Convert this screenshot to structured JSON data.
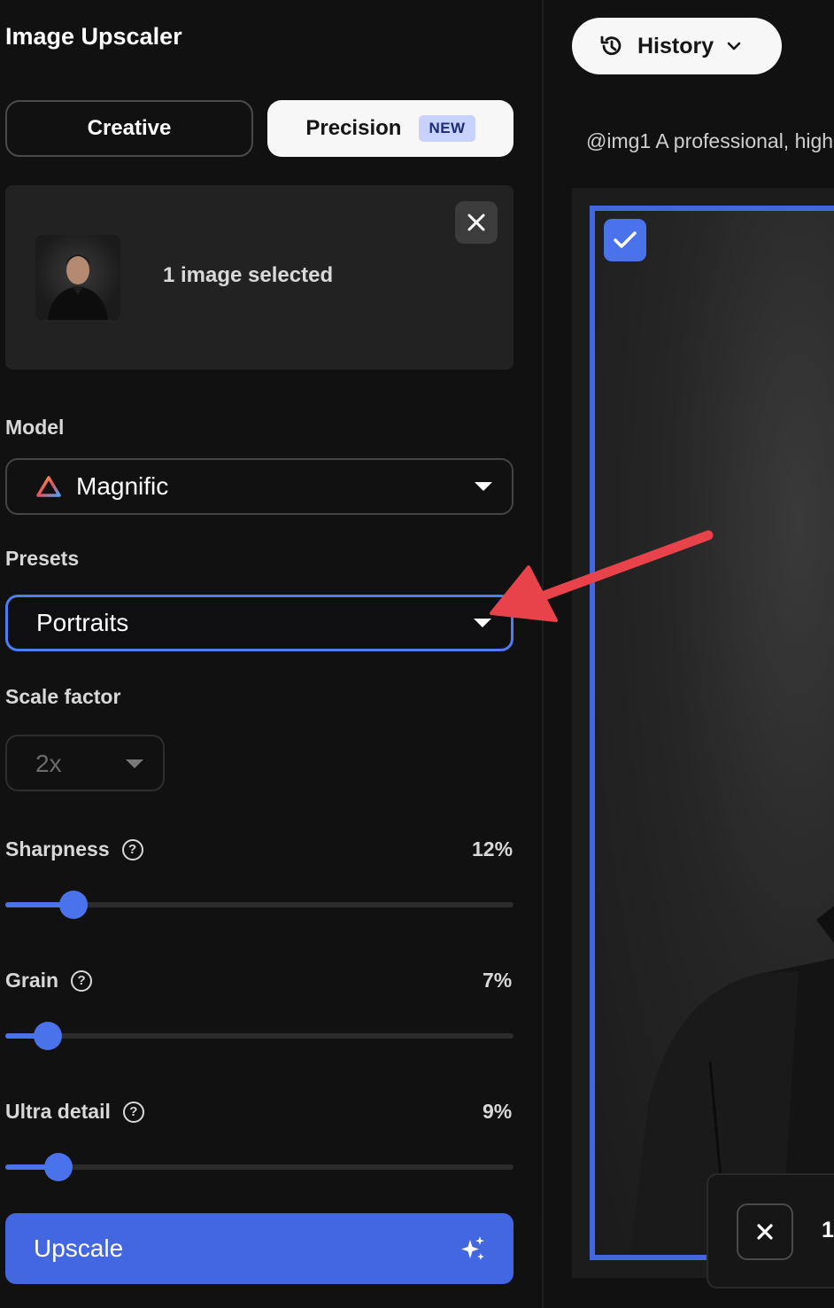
{
  "app": {
    "title": "Image Upscaler"
  },
  "modes": {
    "creative_label": "Creative",
    "precision_label": "Precision",
    "new_badge": "NEW",
    "active": "Precision"
  },
  "selection": {
    "text": "1 image selected"
  },
  "model": {
    "label": "Model",
    "value": "Magnific"
  },
  "presets": {
    "label": "Presets",
    "value": "Portraits"
  },
  "scale": {
    "label": "Scale factor",
    "value": "2x"
  },
  "sliders": [
    {
      "label": "Sharpness",
      "value_text": "12%",
      "value": 12
    },
    {
      "label": "Grain",
      "value_text": "7%",
      "value": 7
    },
    {
      "label": "Ultra detail",
      "value_text": "9%",
      "value": 9
    }
  ],
  "upscale": {
    "label": "Upscale"
  },
  "history": {
    "label": "History"
  },
  "prompt": {
    "text": "@img1 A professional, high"
  },
  "bottom_bar": {
    "count": "1"
  },
  "colors": {
    "accent": "#4267e0",
    "background": "#111111",
    "annotation": "#e8434a"
  }
}
